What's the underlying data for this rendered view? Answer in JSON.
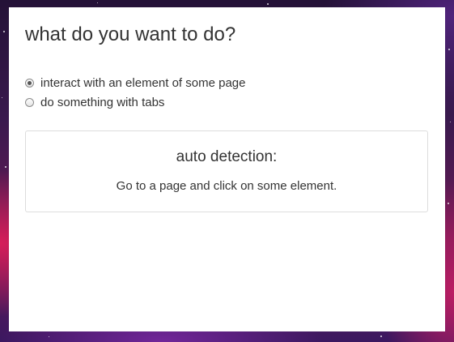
{
  "popup": {
    "title": "what do you want to do?",
    "options": [
      {
        "label": "interact with an element of some page",
        "selected": true
      },
      {
        "label": "do something with tabs",
        "selected": false
      }
    ],
    "card": {
      "title": "auto detection:",
      "text": "Go to a page and click on some element."
    }
  }
}
